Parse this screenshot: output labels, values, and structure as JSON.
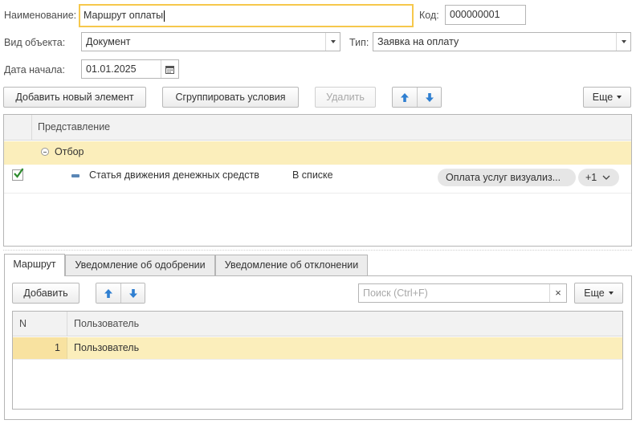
{
  "header": {
    "name_label": "Наименование:",
    "name_value": "Маршрут оплаты",
    "code_label": "Код:",
    "code_value": "000000001",
    "object_type_label": "Вид объекта:",
    "object_type_value": "Документ",
    "type_label": "Тип:",
    "type_value": "Заявка на оплату",
    "start_date_label": "Дата начала:",
    "start_date_value": "01.01.2025"
  },
  "toolbar": {
    "add_new": "Добавить новый элемент",
    "group_conditions": "Сгруппировать условия",
    "delete": "Удалить",
    "more": "Еще"
  },
  "conditions_table": {
    "column_header": "Представление",
    "group_row": {
      "label": "Отбор"
    },
    "condition_row": {
      "field": "Статья движения денежных средств",
      "operator": "В списке",
      "value_chip": "Оплата услуг визуализ...",
      "extra_chip": "+1"
    }
  },
  "tabs": [
    {
      "label": "Маршрут"
    },
    {
      "label": "Уведомление об одобрении"
    },
    {
      "label": "Уведомление об отклонении"
    }
  ],
  "route_panel": {
    "add_button": "Добавить",
    "search_placeholder": "Поиск (Ctrl+F)",
    "clear_search": "×",
    "more": "Еще",
    "columns": {
      "n": "N",
      "user": "Пользователь"
    },
    "rows": [
      {
        "n": "1",
        "user": "Пользователь"
      }
    ]
  },
  "colors": {
    "selection": "#fbeebb",
    "focus_border": "#f6c84c",
    "arrow_blue": "#2f7fd1",
    "check_green": "#2e8b2e"
  }
}
